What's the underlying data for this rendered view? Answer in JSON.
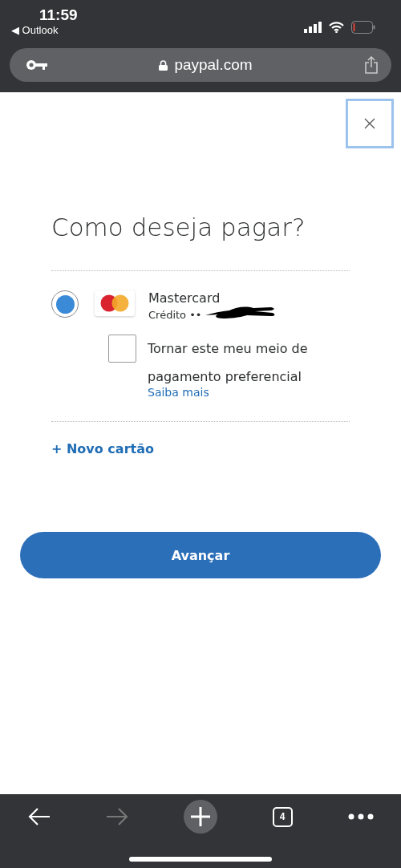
{
  "status_bar": {
    "time": "11:59",
    "back_app": "◀ Outlook"
  },
  "address_bar": {
    "url": "paypal.com"
  },
  "dialog": {
    "title": "Como deseja pagar?",
    "payment_methods": [
      {
        "brand": "Mastercard",
        "detail": "Crédito ••",
        "selected": true,
        "redacted": true,
        "preferred_option": {
          "label": "Tornar este meu meio de pagamento preferencial",
          "checked": false
        },
        "link": "Saiba mais"
      }
    ],
    "add_card": "+ Novo cartão",
    "primary_button": "Avançar"
  },
  "toolbar": {
    "tab_count": "4",
    "forward_disabled": true
  }
}
